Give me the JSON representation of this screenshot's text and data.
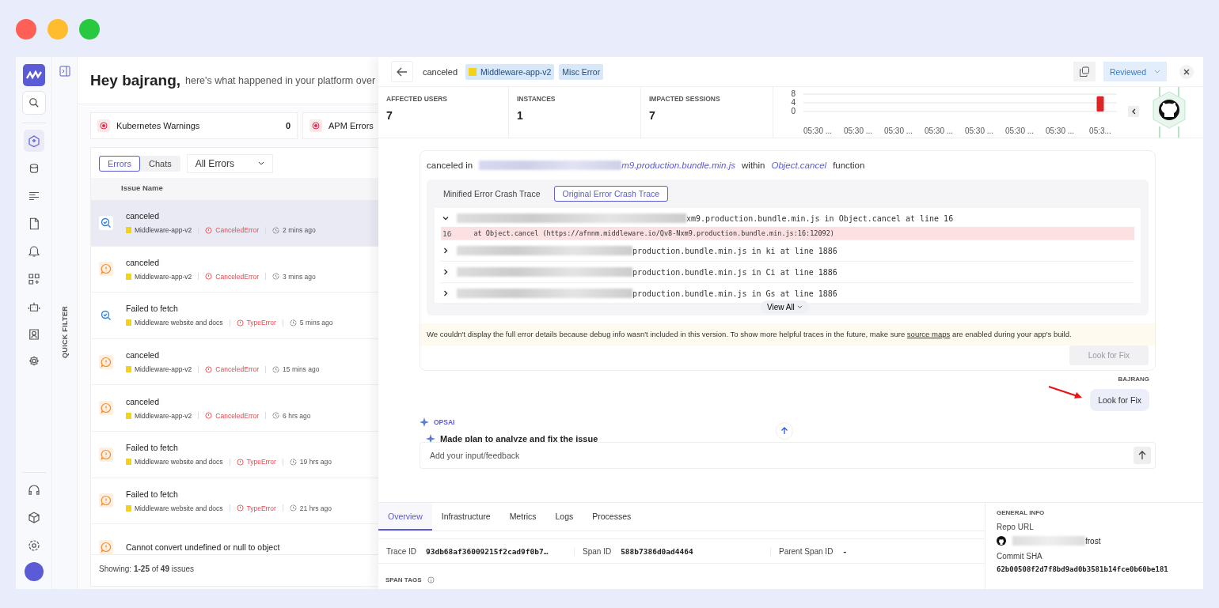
{
  "rail": {
    "items": [
      {
        "selected": true
      },
      {
        "selected": false
      },
      {
        "selected": false
      },
      {
        "selected": false
      },
      {
        "selected": false
      },
      {
        "selected": false
      },
      {
        "selected": false
      },
      {
        "selected": false
      },
      {
        "selected": false
      }
    ]
  },
  "quick_filter": "QUICK FILTER",
  "greeting": {
    "title": "Hey bajrang,",
    "subtitle": "here's what happened in your platform over"
  },
  "summary": [
    {
      "label": "Kubernetes Warnings",
      "count": "0"
    },
    {
      "label": "APM Errors"
    }
  ],
  "list_tabs": [
    {
      "label": "Errors",
      "selected": true
    },
    {
      "label": "Chats",
      "selected": false
    }
  ],
  "filter": {
    "value": "All Errors"
  },
  "list_header": "Issue Name",
  "issues": [
    {
      "kind": "analyzed",
      "selected": true,
      "title": "canceled",
      "app": "Middleware-app-v2",
      "error": "CanceledError",
      "time": "2 mins ago"
    },
    {
      "kind": "warning",
      "selected": false,
      "title": "canceled",
      "app": "Middleware-app-v2",
      "error": "CanceledError",
      "time": "3 mins ago"
    },
    {
      "kind": "analyzed",
      "selected": false,
      "title": "Failed to fetch",
      "app": "Middleware website and docs",
      "error": "TypeError",
      "time": "5 mins ago"
    },
    {
      "kind": "warning",
      "selected": false,
      "title": "canceled",
      "app": "Middleware-app-v2",
      "error": "CanceledError",
      "time": "15 mins ago"
    },
    {
      "kind": "warning",
      "selected": false,
      "title": "canceled",
      "app": "Middleware-app-v2",
      "error": "CanceledError",
      "time": "6 hrs ago"
    },
    {
      "kind": "warning",
      "selected": false,
      "title": "Failed to fetch",
      "app": "Middleware website and docs",
      "error": "TypeError",
      "time": "19 hrs ago"
    },
    {
      "kind": "warning",
      "selected": false,
      "title": "Failed to fetch",
      "app": "Middleware website and docs",
      "error": "TypeError",
      "time": "21 hrs ago"
    },
    {
      "kind": "warning",
      "selected": false,
      "title": "Cannot convert undefined or null to object"
    }
  ],
  "list_footer": "Showing: **1-25** of **49** issues",
  "detail": {
    "title": "canceled",
    "app_chip": "Middleware-app-v2",
    "type_chip": "Misc Error",
    "status": "Reviewed"
  },
  "stats": [
    {
      "label": "AFFECTED USERS",
      "value": "7"
    },
    {
      "label": "INSTANCES",
      "value": "1"
    },
    {
      "label": "IMPACTED SESSIONS",
      "value": "7"
    }
  ],
  "chart_data": {
    "type": "bar",
    "categories": [
      "05:30 ...",
      "05:30 ...",
      "05:30 ...",
      "05:30 ...",
      "05:30 ...",
      "05:30 ...",
      "05:30 ...",
      "05:3..."
    ],
    "values": [
      0,
      0,
      0,
      0,
      0,
      0,
      0,
      7
    ],
    "ylim": [
      0,
      8
    ],
    "yticks": [
      0,
      4,
      8
    ]
  },
  "summary_line": {
    "prefix": "canceled in",
    "file": "m9.production.bundle.min.js",
    "within": "within",
    "function": "Object.cancel",
    "suffix": "function"
  },
  "trace_tabs": [
    {
      "label": "Minified Error Crash Trace",
      "selected": false
    },
    {
      "label": "Original Error Crash Trace",
      "selected": true
    }
  ],
  "frames": [
    {
      "expanded": true,
      "text": "xm9.production.bundle.min.js in Object.cancel at line 16",
      "line_no": "16",
      "code": "at Object.cancel (https://afnnm.middleware.io/Qv8-Nxm9.production.bundle.min.js:16:12092)"
    },
    {
      "expanded": false,
      "text": "production.bundle.min.js in ki at line 1886"
    },
    {
      "expanded": false,
      "text": "production.bundle.min.js in Ci at line 1886"
    },
    {
      "expanded": false,
      "text": "production.bundle.min.js in Gs at line 1886"
    }
  ],
  "view_all": "View All",
  "notice": {
    "before": "We couldn't display the full error details because debug info wasn't included in this version. To show more helpful traces in the future, make sure",
    "link": "source maps",
    "after": "are enabled during your app's build."
  },
  "fix_button": {
    "label": "Look for Fix",
    "disabled": true
  },
  "user_message": {
    "author": "BAJRANG",
    "text": "Look for Fix"
  },
  "assistant": {
    "author": "OPSAI",
    "step": "Made plan to analyze and fix the issue"
  },
  "input": {
    "placeholder": "Add your input/feedback"
  },
  "bottom_tabs": [
    {
      "label": "Overview",
      "selected": true
    },
    {
      "label": "Infrastructure",
      "selected": false
    },
    {
      "label": "Metrics",
      "selected": false
    },
    {
      "label": "Logs",
      "selected": false
    },
    {
      "label": "Processes",
      "selected": false
    }
  ],
  "ids": [
    {
      "label": "Trace ID",
      "value": "93db68af36009215f2cad9f0b7…"
    },
    {
      "label": "Span ID",
      "value": "588b7386d0ad4464"
    },
    {
      "label": "Parent Span ID",
      "value": "-"
    }
  ],
  "span_tags": "SPAN TAGS",
  "general_info": {
    "title": "GENERAL INFO",
    "repo_label": "Repo URL",
    "repo_value": "frost",
    "sha_label": "Commit SHA",
    "sha_value": "62b00508f2d7f8bd9ad0b3581b14fce0b60be181"
  }
}
